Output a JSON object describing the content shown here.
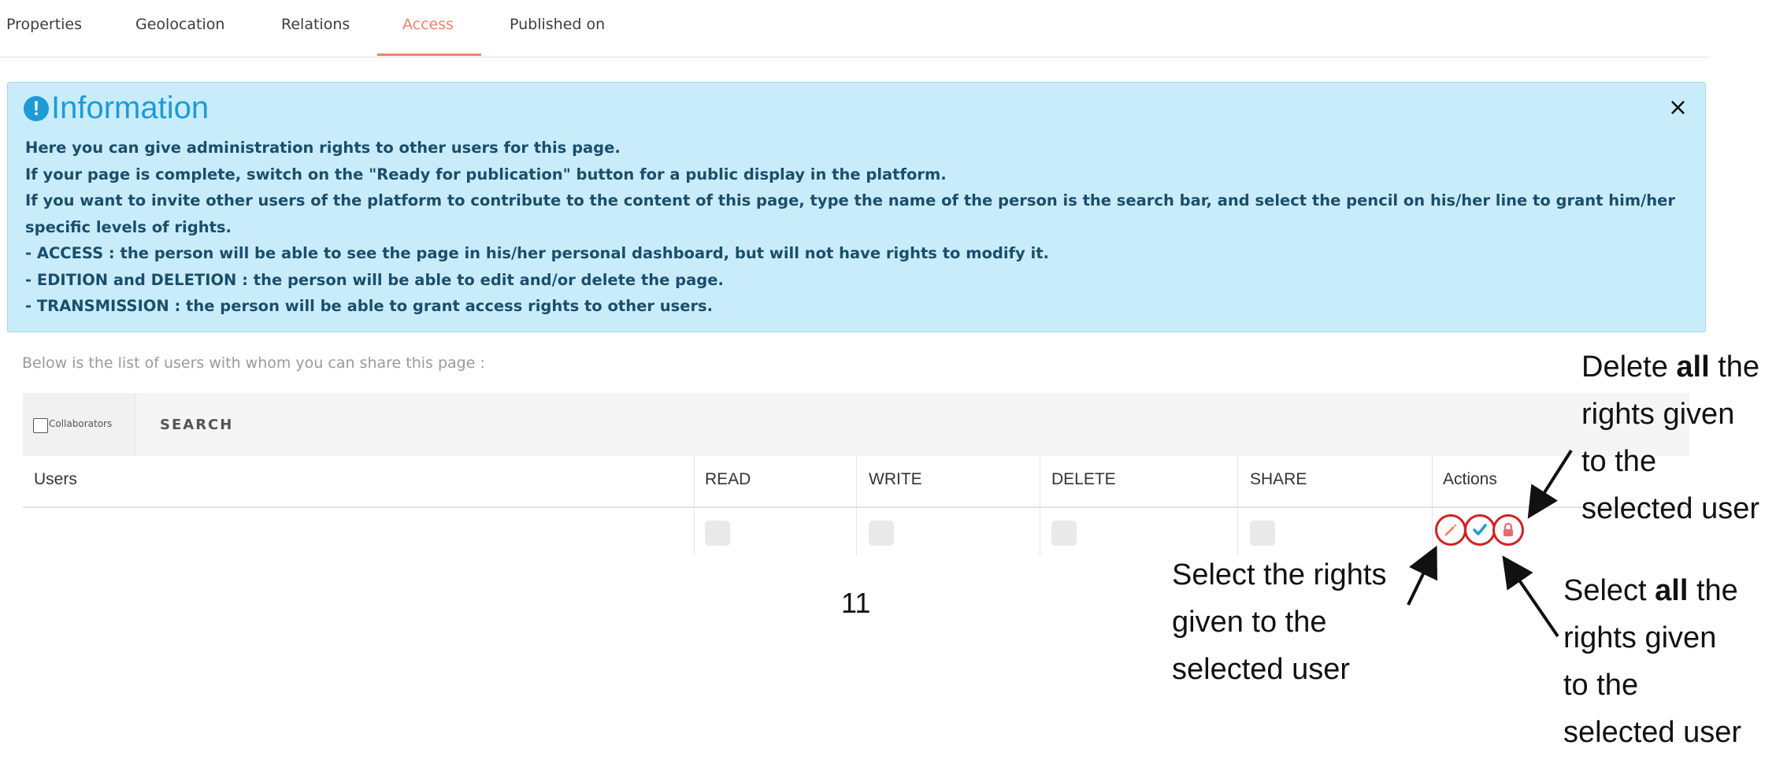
{
  "tabs": [
    {
      "label": "Properties"
    },
    {
      "label": "Geolocation"
    },
    {
      "label": "Relations"
    },
    {
      "label": "Access"
    },
    {
      "label": "Published on"
    }
  ],
  "info": {
    "title": "Information",
    "close": "×",
    "lines": [
      "Here you can give administration rights to other users for this page.",
      "If your page is complete, switch on the \"Ready for publication\" button for a public display in the platform.",
      "If you want to invite other users of the platform to contribute to the content of this page, type the name of the person is the search bar, and select the pencil on his/her line to grant him/her specific levels of rights.",
      "- ACCESS : the person will be able to see the page in his/her personal dashboard, but will not have rights to modify it.",
      "- EDITION and DELETION : the person will be able to edit and/or delete the page.",
      "- TRANSMISSION : the person will be able to grant access rights to other users."
    ]
  },
  "share_text": "Below is the list of users with whom you can share this page :",
  "toolbar": {
    "collaborators": "Collaborators",
    "search": "SEARCH"
  },
  "table": {
    "headers": [
      "Users",
      "READ",
      "WRITE",
      "DELETE",
      "SHARE",
      "Actions"
    ]
  },
  "page_number": "11",
  "annotations": {
    "delete": {
      "pre": "Delete ",
      "bold": "all",
      "post": " the",
      "line2": "rights given",
      "line3": "to the",
      "line4": "selected user"
    },
    "select_rights": {
      "line1": "Select the rights",
      "line2": "given to the",
      "line3": "selected user"
    },
    "select_all": {
      "pre": "Select ",
      "bold": "all",
      "post": " the",
      "line2": "rights given",
      "line3": "to the",
      "line4": "selected user"
    }
  },
  "colors": {
    "accent": "#f0826a",
    "info_bg": "#c9ecfb",
    "info_title": "#1e9bd7",
    "highlight_circle": "#d42020"
  }
}
